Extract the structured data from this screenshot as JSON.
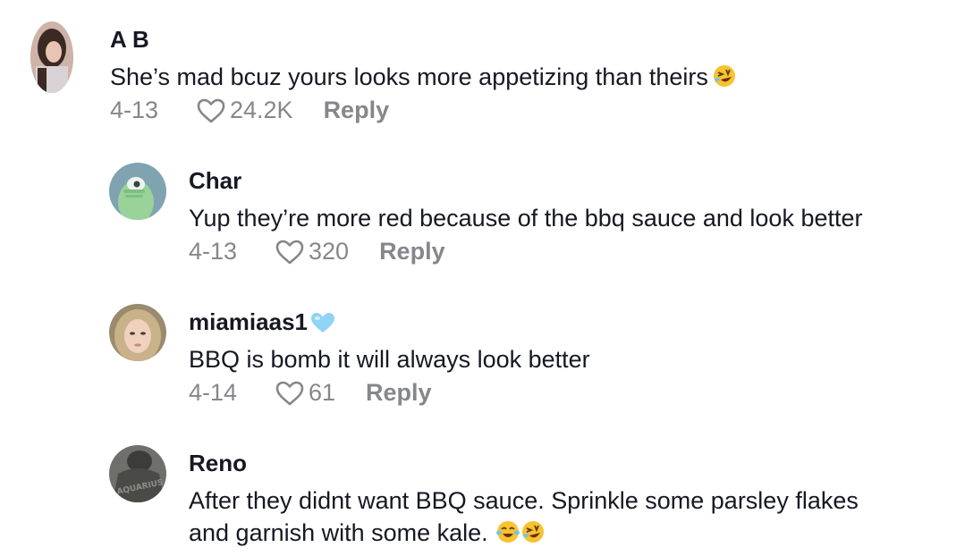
{
  "comments": [
    {
      "username": "A B",
      "text": "She’s mad bcuz yours looks more appetizing than theirs",
      "text_emojis": [
        "rolling-on-floor-laughing"
      ],
      "date": "4-13",
      "likes": "24.2K",
      "reply_label": "Reply",
      "avatar": "photo-woman-dark-hair"
    },
    {
      "username": "Char",
      "text": "Yup they’re more red because of the bbq sauce and look better",
      "date": "4-13",
      "likes": "320",
      "reply_label": "Reply",
      "avatar": "green-monster-cartoon"
    },
    {
      "username": "miamiaas1",
      "username_badge": "light-blue-heart",
      "text": "BBQ is bomb it will always look better",
      "date": "4-14",
      "likes": "61",
      "reply_label": "Reply",
      "avatar": "photo-woman-blonde"
    },
    {
      "username": "Reno",
      "text_line1": "After they didnt want BBQ sauce. Sprinkle some parsley flakes",
      "text_line2": "and garnish with some kale.",
      "text_emojis": [
        "face-with-tears-of-joy",
        "rolling-on-floor-laughing"
      ],
      "avatar": "photo-aquarius-hoodie",
      "avatar_text": "AQUARIUS"
    }
  ],
  "colors": {
    "primary_text": "#161823",
    "secondary_text": "#86878b",
    "background": "#ffffff",
    "heart_badge": "#8fd3f5",
    "emoji_yellow": "#f7c32e"
  }
}
